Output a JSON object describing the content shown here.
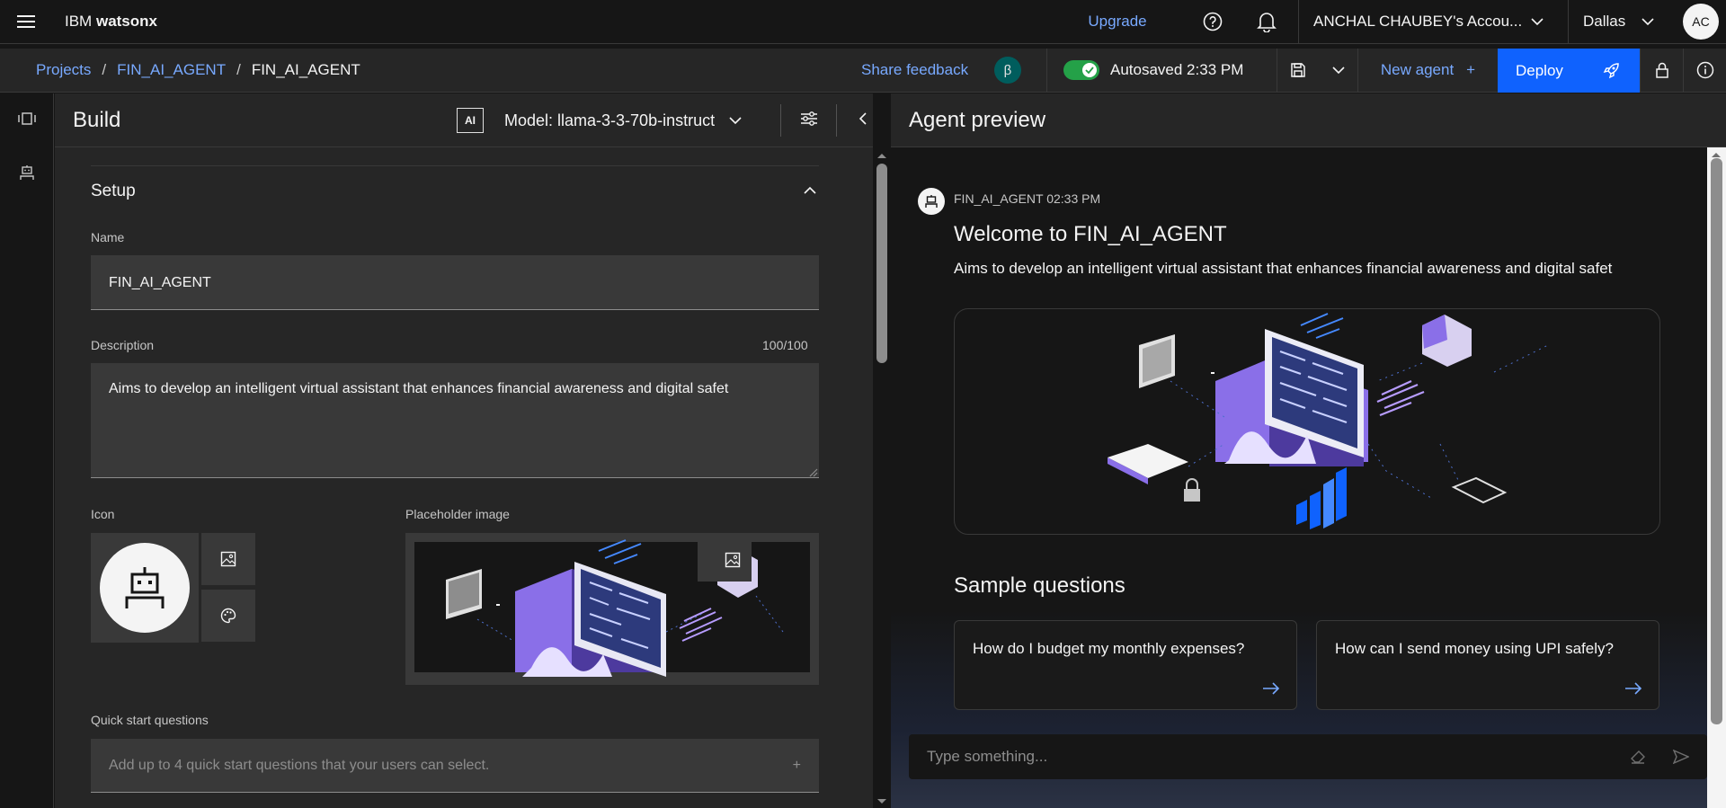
{
  "header": {
    "brand_prefix": "IBM",
    "brand_name": "watsonx",
    "upgrade": "Upgrade",
    "account": "ANCHAL CHAUBEY's Accou...",
    "region": "Dallas",
    "avatar_initials": "AC"
  },
  "subheader": {
    "breadcrumbs": [
      "Projects",
      "FIN_AI_AGENT",
      "FIN_AI_AGENT"
    ],
    "separator": "/",
    "feedback": "Share feedback",
    "beta": "β",
    "autosave": "Autosaved 2:33 PM",
    "new_agent": "New agent",
    "new_agent_plus": "+",
    "deploy": "Deploy"
  },
  "build": {
    "title": "Build",
    "ai_badge": "AI",
    "model": "Model: llama-3-3-70b-instruct",
    "setup_title": "Setup",
    "name_label": "Name",
    "name_value": "FIN_AI_AGENT",
    "description_label": "Description",
    "description_count": "100/100",
    "description_value": "Aims to develop an intelligent virtual assistant that enhances financial awareness and digital safet",
    "icon_label": "Icon",
    "placeholder_label": "Placeholder image",
    "quick_start_label": "Quick start questions",
    "quick_start_placeholder": "Add up to 4 quick start questions that your users can select.",
    "quick_start_plus": "+"
  },
  "preview": {
    "title": "Agent preview",
    "meta": "FIN_AI_AGENT 02:33 PM",
    "welcome": "Welcome to FIN_AI_AGENT",
    "description": "Aims to develop an intelligent virtual assistant that enhances financial awareness and digital safet",
    "sample_title": "Sample questions",
    "questions": [
      "How do I budget my monthly expenses?",
      "How can I send money using UPI safely?"
    ],
    "input_placeholder": "Type something..."
  },
  "colors": {
    "accent": "#0f62fe",
    "link": "#78a9ff",
    "toggle_on": "#24a148",
    "illustration_purple": "#8a6fe8"
  }
}
